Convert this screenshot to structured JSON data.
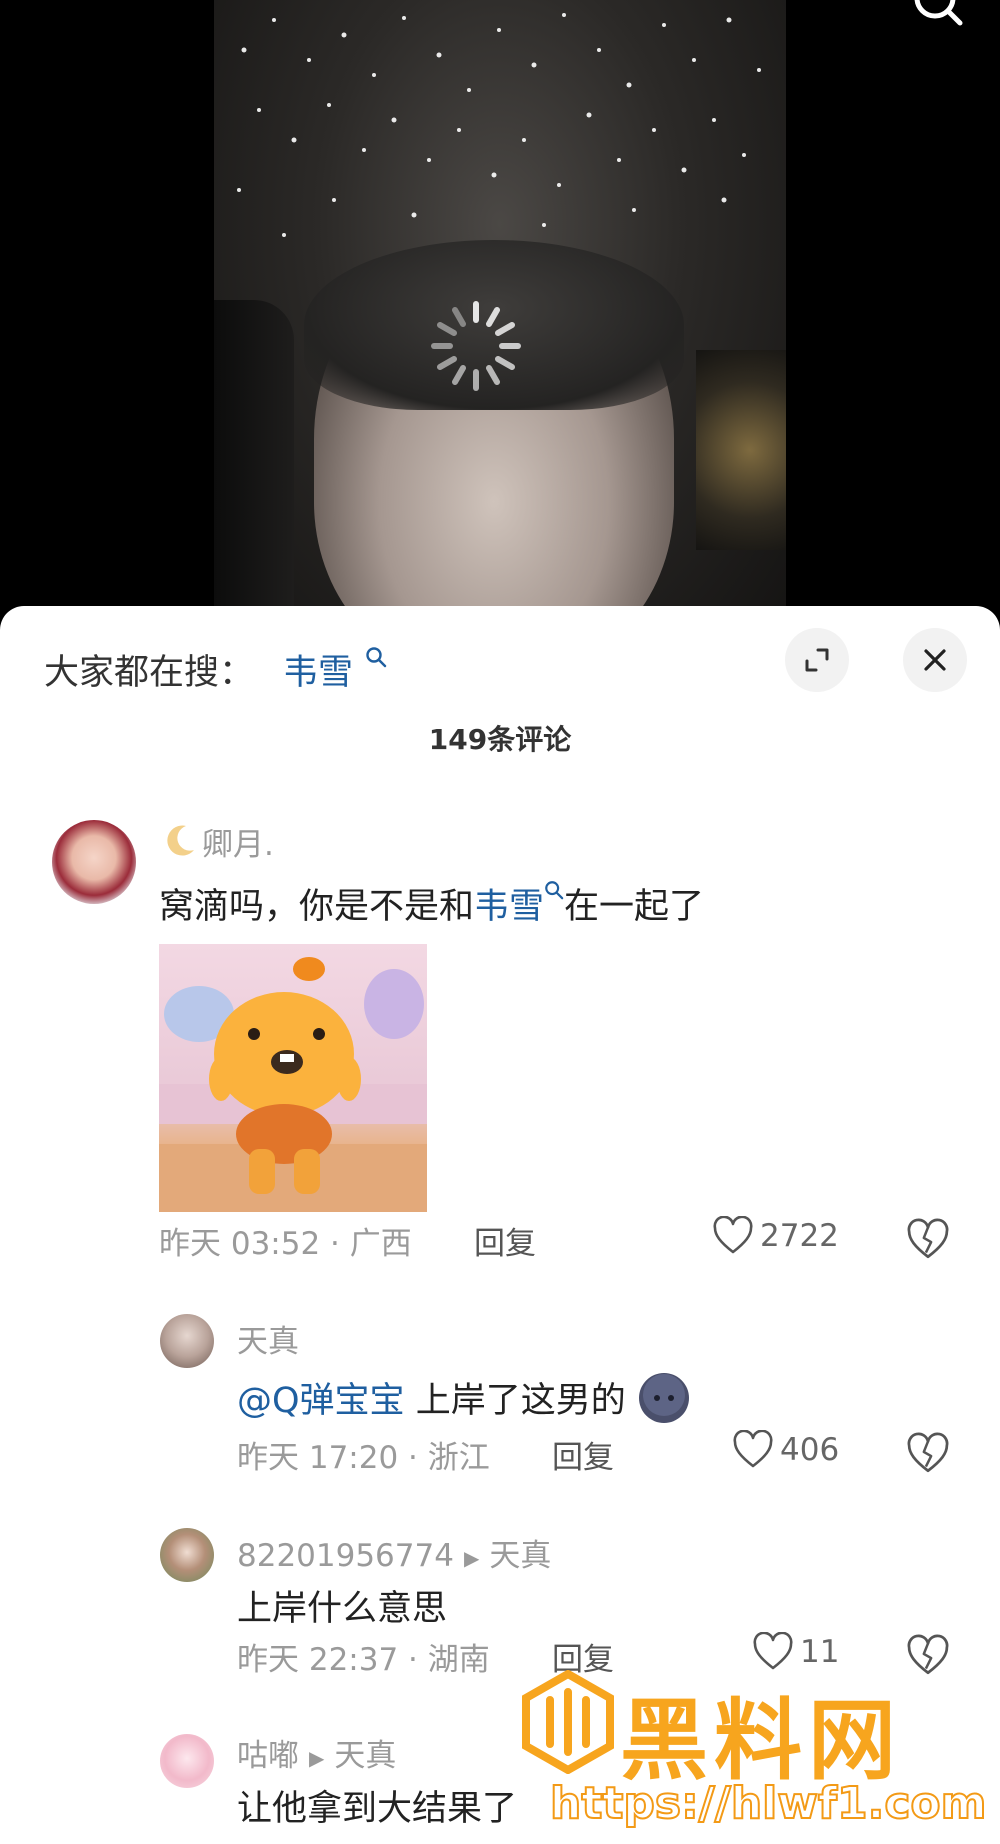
{
  "sheet": {
    "search_label": "大家都在搜：",
    "search_term": "韦雪",
    "comment_count": "149条评论"
  },
  "comments": [
    {
      "name": "卿月.",
      "text_before": "窝滴吗，你是不是和",
      "link": "韦雪",
      "text_after": "在一起了",
      "time": "昨天 03:52 · 广西",
      "reply": "回复",
      "likes": "2722"
    }
  ],
  "replies": [
    {
      "name": "天真",
      "mention": "@Q弹宝宝",
      "text": " 上岸了这男的",
      "time": "昨天 17:20 · 浙江",
      "reply": "回复",
      "likes": "406"
    },
    {
      "name": "82201956774",
      "reply_to": "天真",
      "text": "上岸什么意思",
      "time": "昨天 22:37 · 湖南",
      "reply": "回复",
      "likes": "11"
    },
    {
      "name": "咕嘟",
      "reply_to": "天真",
      "text": "让他拿到大结果了"
    }
  ],
  "watermark": {
    "title": "黑料网",
    "url": "https://hlwf1.com"
  },
  "colors": {
    "link": "#1f5fa0",
    "watermark": "#f7a51e"
  },
  "icons": [
    "search-icon",
    "loading-spinner-icon",
    "expand-icon",
    "close-icon",
    "heart-icon",
    "broken-heart-icon",
    "moon-icon",
    "emoji-icon"
  ]
}
